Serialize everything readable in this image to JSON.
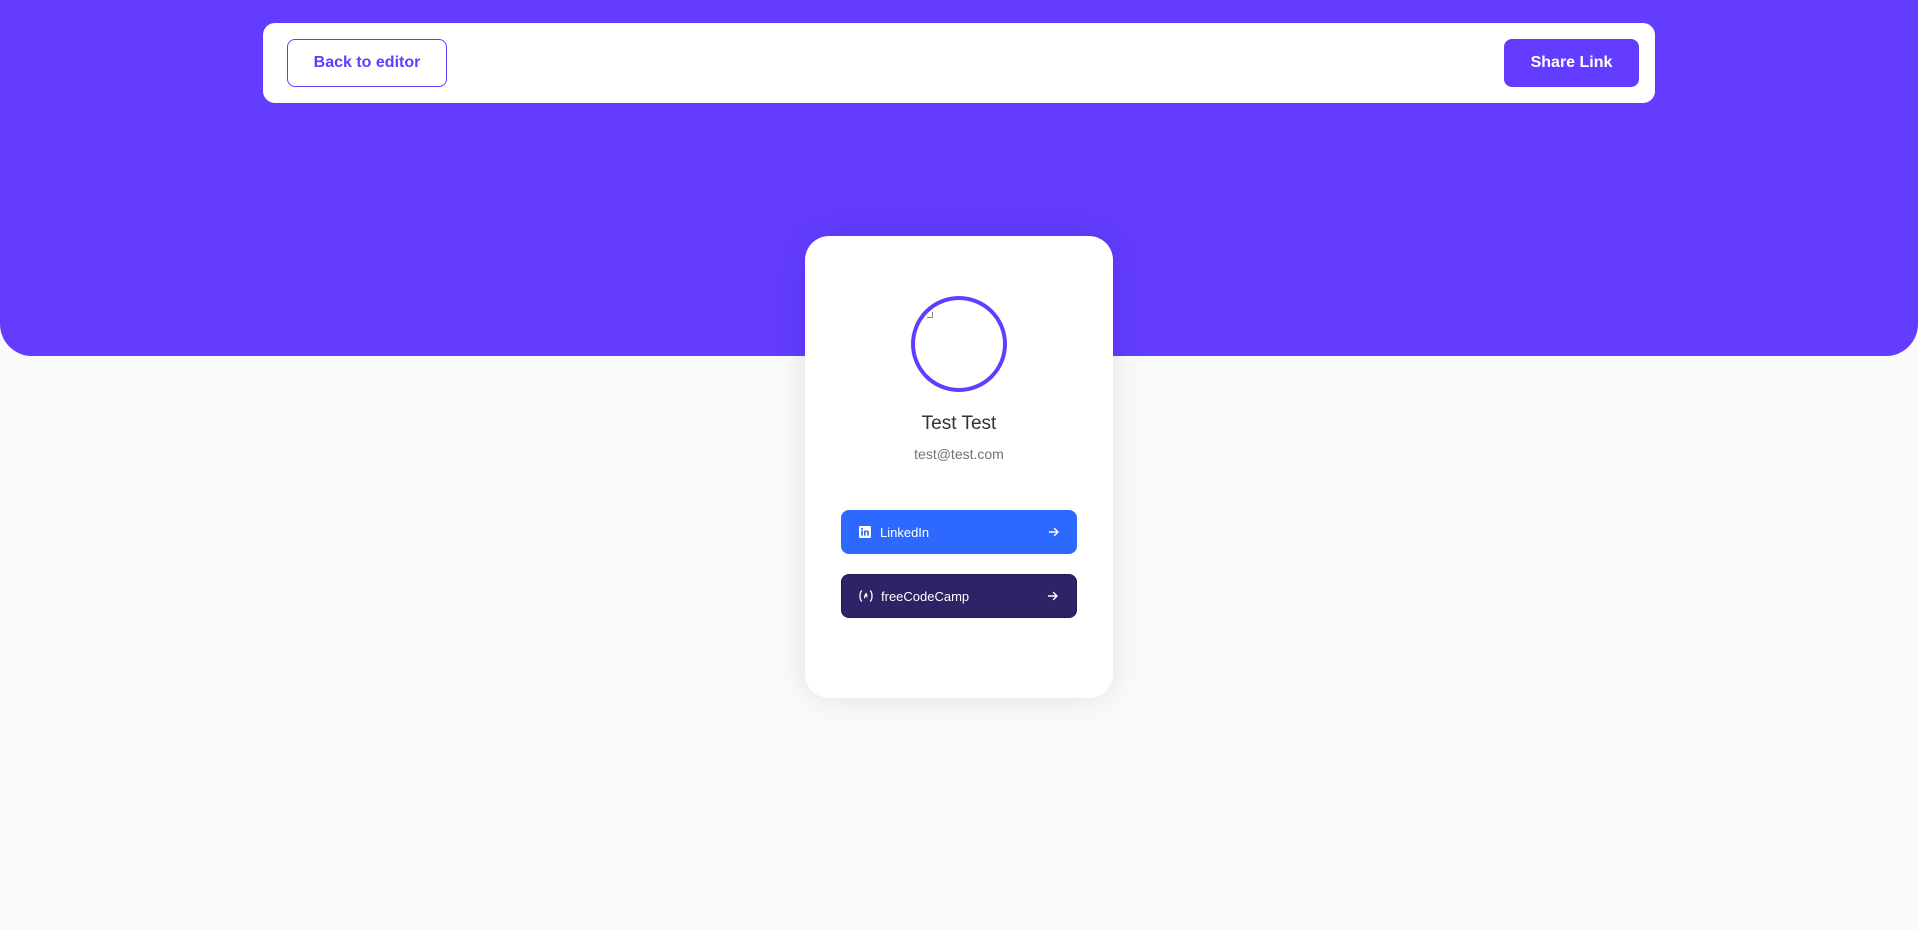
{
  "header": {
    "back_label": "Back to editor",
    "share_label": "Share Link"
  },
  "profile": {
    "name": "Test Test",
    "email": "test@test.com",
    "avatar_icon": "broken-image-icon"
  },
  "links": [
    {
      "platform": "LinkedIn",
      "icon": "linkedin-icon",
      "color": "#2d68ff"
    },
    {
      "platform": "freeCodeCamp",
      "icon": "freecodecamp-icon",
      "color": "#302267"
    }
  ],
  "colors": {
    "accent": "#633cff",
    "background": "#fafafa"
  }
}
